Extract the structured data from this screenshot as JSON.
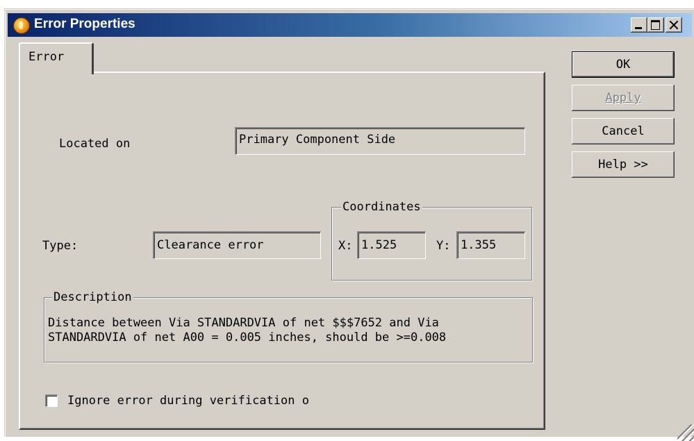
{
  "window": {
    "title": "Error Properties",
    "icon": "app-flame-icon",
    "controls": {
      "minimize": "minimize-icon",
      "maximize": "maximize-icon",
      "close": "close-icon"
    }
  },
  "tabs": [
    {
      "label": "Error",
      "selected": true
    }
  ],
  "buttons": {
    "ok": "OK",
    "apply": "Apply",
    "apply_enabled": false,
    "cancel": "Cancel",
    "help": "Help >>"
  },
  "form": {
    "located_on_label": "Located on",
    "located_on_value": "Primary Component Side",
    "type_label": "Type:",
    "type_value": "Clearance error",
    "coordinates_label": "Coordinates",
    "x_label": "X:",
    "x_value": "1.525",
    "y_label": "Y:",
    "y_value": "1.355",
    "description_label": "Description",
    "description_line1": "Distance between Via STANDARDVIA of net $$$7652 and Via",
    "description_line2": "STANDARDVIA of net A00 = 0.005 inches, should be >=0.008",
    "ignore_label": "Ignore error during verification o",
    "ignore_checked": false
  },
  "colors": {
    "face": "#d4d0c8",
    "title_gradient_start": "#0a246a",
    "title_gradient_end": "#a6caf0",
    "disabled_text": "#808080"
  }
}
